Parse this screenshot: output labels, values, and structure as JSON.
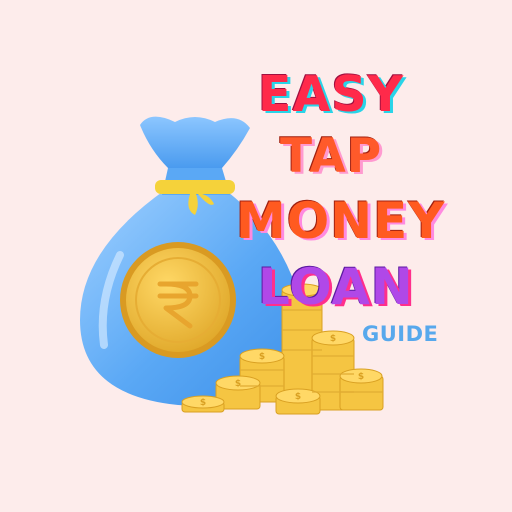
{
  "title": {
    "line1": "EASY",
    "line2": "TAP",
    "line3": "MONEY",
    "line4": "LOAN"
  },
  "subtitle": "GUIDE",
  "icons": {
    "bag": "money-bag-icon",
    "coin": "rupee-coin-icon",
    "stacks": "coin-stack-icon"
  },
  "colors": {
    "background": "#fdeceb",
    "bag": "#5aa8f5",
    "coin": "#f2c14a",
    "tie": "#f5d23a"
  }
}
